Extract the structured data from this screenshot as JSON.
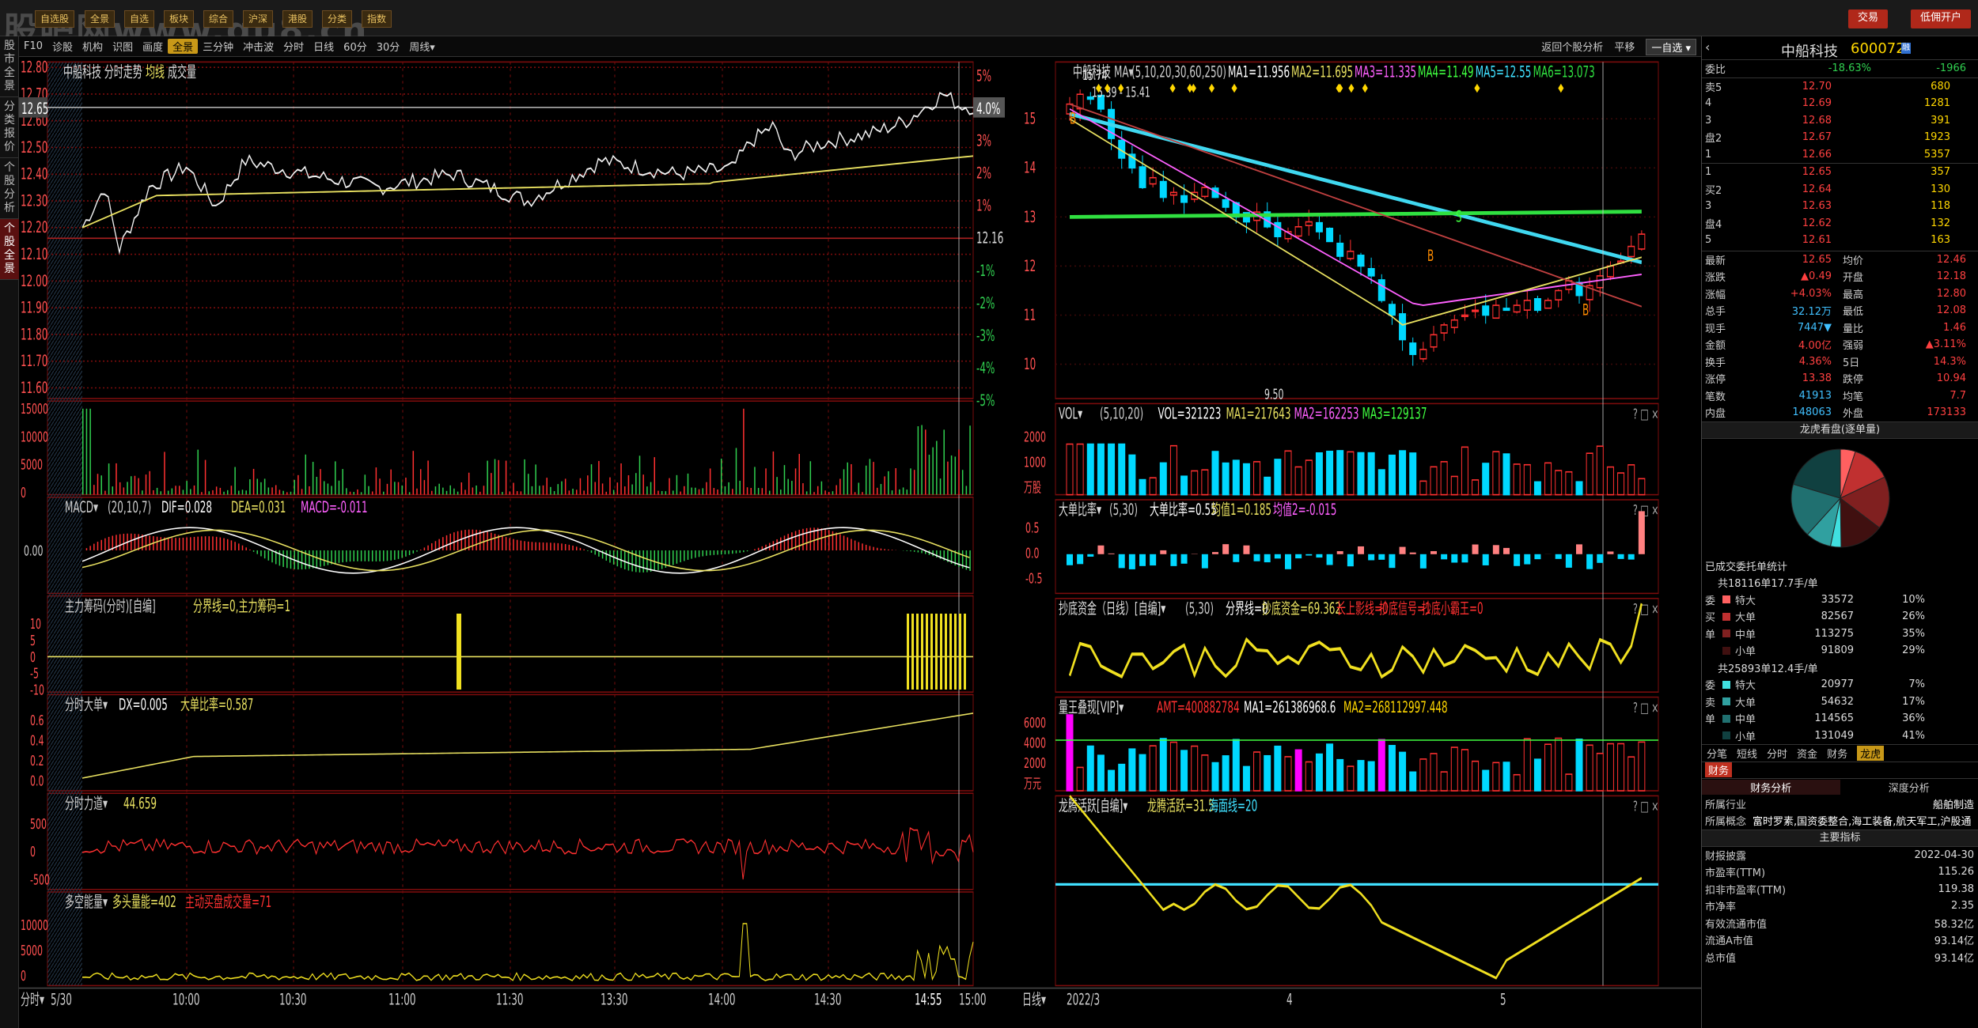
{
  "header": {
    "watermark": "股吧网www.gu8.cn",
    "tabs": [
      "自选股",
      "全景",
      "自选",
      "板块",
      "综合",
      "沪深",
      "港股",
      "分类",
      "指数"
    ],
    "right_buttons": [
      "交易",
      "低佣开户"
    ]
  },
  "leftnav": [
    "股市全景",
    "分类报价",
    "个股分析",
    "个股全景"
  ],
  "toolbar": {
    "items": [
      "F10",
      "诊股",
      "机构",
      "识图",
      "画度",
      "全景",
      "三分钟",
      "冲击波",
      "分时",
      "日线",
      "60分",
      "30分",
      "周线▾"
    ],
    "active": "全景",
    "right": [
      "返回个股分析",
      "平移",
      "一自选 ▾"
    ]
  },
  "intraday": {
    "title": "中船科技 分时走势",
    "legend": [
      "均线",
      "成交量"
    ],
    "price_axis": [
      "12.80",
      "12.70",
      "12.60",
      "12.50",
      "12.40",
      "12.30",
      "12.20",
      "12.10",
      "12.00",
      "11.90",
      "11.80",
      "11.70",
      "11.60"
    ],
    "pct_axis": [
      "5%",
      "4.0%",
      "3%",
      "2%",
      "1%",
      "12.16",
      "-1%",
      "-2%",
      "-3%",
      "-4%",
      "-5%"
    ],
    "current_price": "12.65",
    "current_pct": "4.0%",
    "prev_close": "12.16",
    "vol_axis": [
      "15000",
      "10000",
      "5000",
      "0"
    ],
    "time_axis": [
      "5/30",
      "10:00",
      "10:30",
      "11:00",
      "11:30",
      "13:30",
      "14:00",
      "14:30",
      "14:55",
      "15:00"
    ],
    "bottom_label": "分时",
    "macd": {
      "title": "MACD",
      "params": "(20,10,7)",
      "dif": "DIF=0.028",
      "dea": "DEA=0.031",
      "macd": "MACD=-0.011",
      "axis": [
        "0.00"
      ]
    },
    "zlcm": {
      "title": "主力筹码(分时)[自编]",
      "txt": "分界线=0,主力筹码=1",
      "axis": [
        "10",
        "5",
        "0",
        "-5",
        "-10"
      ]
    },
    "fsdd": {
      "title": "分时大单",
      "txt": "DX=0.005",
      "txt2": "大单比率=0.587",
      "axis": [
        "0.6",
        "0.4",
        "0.2",
        "0.0"
      ]
    },
    "fsld": {
      "title": "分时力道",
      "txt": "44.659",
      "axis": [
        "500",
        "0",
        "-500"
      ]
    },
    "dkn": {
      "title": "多空能量",
      "txt": "多头量能=402",
      "txt2": "主动买盘成交量=71",
      "axis": [
        "10000",
        "5000",
        "0"
      ]
    }
  },
  "daily": {
    "title": "中船科技",
    "ma_label": "MA",
    "ma_params": "(5,10,20,30,60,250)",
    "ma": [
      "MA1=11.956",
      "MA2=11.695",
      "MA3=11.335",
      "MA4=11.49",
      "MA5=12.55",
      "MA6=13.073"
    ],
    "price_axis": [
      "15",
      "14",
      "13",
      "12",
      "11",
      "10"
    ],
    "annot": [
      "15.74",
      "15.39 - 15.41",
      "9.50"
    ],
    "vol": {
      "title": "VOL",
      "params": "(5,10,20)",
      "vals": [
        "VOL=321223",
        "MA1=217643",
        "MA2=162253",
        "MA3=129137"
      ],
      "axis": [
        "2000",
        "1000",
        "万股"
      ]
    },
    "ddbl": {
      "title": "大单比率",
      "params": "(5,30)",
      "vals": [
        "大单比率=0.55",
        "均值1=0.185",
        "均值2=-0.015"
      ],
      "axis": [
        "0.5",
        "0.0",
        "-0.5"
      ]
    },
    "cdzj": {
      "title": "抄底资金（日线）[自编]",
      "params": "(5,30)",
      "vals": [
        "分界线=0",
        "抄底资金=69.362",
        "长上影线=0",
        "抄底信号=1",
        "抄底小霸王=0"
      ]
    },
    "lw": {
      "title": "量王叠现[VIP]",
      "vals": [
        "AMT=400882784",
        "MA1=261386968.6",
        "MA2=268112997.448"
      ],
      "axis": [
        "6000",
        "4000",
        "2000",
        "万元"
      ]
    },
    "lths": {
      "title": "龙腾活跃[自编]",
      "vals": [
        "龙腾活跃=31.5",
        "海面线=20"
      ]
    },
    "time_axis": [
      "2022/3",
      "4",
      "5"
    ],
    "bottom_label": "日线"
  },
  "quote": {
    "name": "中船科技",
    "code": "600072",
    "weibi_label": "委比",
    "weibi": "-18.63%",
    "weicha": "-1966",
    "sells": [
      [
        "卖5",
        "12.70",
        "680"
      ],
      [
        "4",
        "12.69",
        "1281"
      ],
      [
        "3",
        "12.68",
        "391"
      ],
      [
        "盘2",
        "12.67",
        "1923"
      ],
      [
        "1",
        "12.66",
        "5357"
      ]
    ],
    "buys": [
      [
        "1",
        "12.65",
        "357"
      ],
      [
        "买2",
        "12.64",
        "130"
      ],
      [
        "3",
        "12.63",
        "118"
      ],
      [
        "盘4",
        "12.62",
        "132"
      ],
      [
        "5",
        "12.61",
        "163"
      ]
    ],
    "stats": [
      [
        "最新",
        "12.65",
        "均价",
        "12.46"
      ],
      [
        "涨跌",
        "▲0.49",
        "开盘",
        "12.18"
      ],
      [
        "涨幅",
        "+4.03%",
        "最高",
        "12.80"
      ],
      [
        "总手",
        "32.12万",
        "最低",
        "12.08"
      ],
      [
        "现手",
        "7447▼",
        "量比",
        "1.46"
      ],
      [
        "金额",
        "4.00亿",
        "强弱",
        "▲3.11%"
      ],
      [
        "换手",
        "4.36%",
        "5日",
        "14.3%"
      ],
      [
        "涨停",
        "13.38",
        "跌停",
        "10.94"
      ],
      [
        "笔数",
        "41913",
        "均笔",
        "7.7"
      ],
      [
        "内盘",
        "148063",
        "外盘",
        "173133"
      ]
    ],
    "lhtitle": "龙虎看盘(逐单量)",
    "wt_title": "已成交委托单统计",
    "buy_total": "共18116单17.7手/单",
    "buy_rows": [
      [
        "特大",
        "33572",
        "10%"
      ],
      [
        "大单",
        "82567",
        "26%"
      ],
      [
        "中单",
        "113275",
        "35%"
      ],
      [
        "小单",
        "91809",
        "29%"
      ]
    ],
    "sell_total": "共25893单12.4手/单",
    "sell_rows": [
      [
        "特大",
        "20977",
        "7%"
      ],
      [
        "大单",
        "54632",
        "17%"
      ],
      [
        "中单",
        "114565",
        "36%"
      ],
      [
        "小单",
        "131049",
        "41%"
      ]
    ],
    "side_buy": [
      "委",
      "买",
      "单"
    ],
    "side_sell": [
      "委",
      "卖",
      "单"
    ],
    "tabs": [
      "分笔",
      "短线",
      "分时",
      "资金",
      "财务",
      "龙虎"
    ],
    "fin_tab": "财务",
    "fin_sub": [
      "财务分析",
      "深度分析"
    ],
    "industry_label": "所属行业",
    "industry": "船舶制造",
    "concept_label": "所属概念",
    "concept": "富时罗素,国资委整合,海工装备,航天军工,沪股通",
    "indicator_title": "主要指标",
    "fin": [
      [
        "财报披露",
        "2022-04-30"
      ],
      [
        "市盈率(TTM)",
        "115.26"
      ],
      [
        "扣非市盈率(TTM)",
        "119.38"
      ],
      [
        "市净率",
        "2.35"
      ],
      [
        "有效流通市值",
        "58.32亿"
      ],
      [
        "流通A市值",
        "93.14亿"
      ],
      [
        "总市值",
        "93.14亿"
      ]
    ]
  },
  "colors": {
    "up": "#ff3030",
    "down": "#00d8ff",
    "ma_yellow": "#e8e060",
    "grid": "#8a1010"
  }
}
